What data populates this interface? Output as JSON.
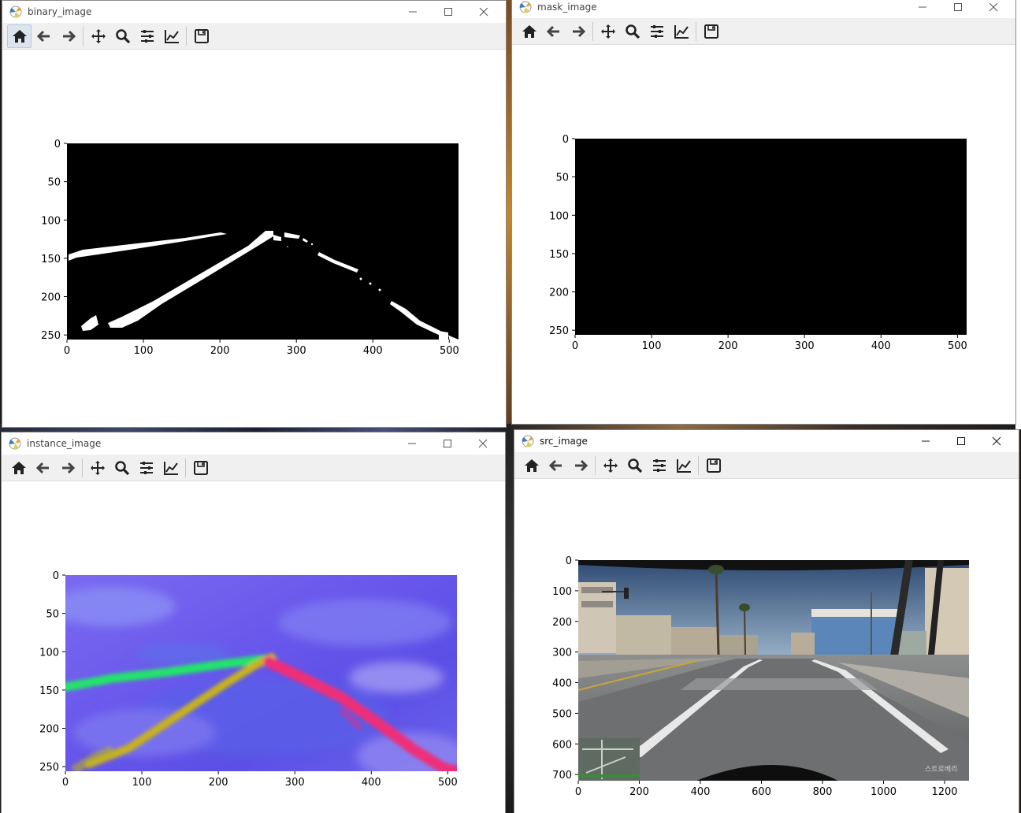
{
  "windows": {
    "binary": {
      "title": "binary_image"
    },
    "mask": {
      "title": "mask_image"
    },
    "instance": {
      "title": "instance_image"
    },
    "src": {
      "title": "src_image"
    }
  },
  "toolbar": {
    "buttons": [
      "home-icon",
      "back-icon",
      "forward-icon",
      "pan-icon",
      "zoom-icon",
      "configure-subplots-icon",
      "edit-axis-icon",
      "save-icon"
    ]
  },
  "window_buttons": [
    "minimize-icon",
    "maximize-icon",
    "close-icon"
  ],
  "colors": {
    "instance_bg": "#6a55ee",
    "lane_green": "#22e46a",
    "lane_yellow": "#c7b21a",
    "lane_pink": "#ef2f78"
  },
  "chart_data": [
    {
      "name": "binary_image",
      "type": "image",
      "x_ticks": [
        "0",
        "100",
        "200",
        "300",
        "400",
        "500"
      ],
      "y_ticks": [
        "0",
        "50",
        "100",
        "150",
        "200",
        "250"
      ],
      "xlim": [
        0,
        512
      ],
      "ylim": [
        256,
        0
      ],
      "content": "binary lane mask"
    },
    {
      "name": "mask_image",
      "type": "image",
      "x_ticks": [
        "0",
        "100",
        "200",
        "300",
        "400",
        "500"
      ],
      "y_ticks": [
        "0",
        "50",
        "100",
        "150",
        "200",
        "250"
      ],
      "xlim": [
        0,
        512
      ],
      "ylim": [
        256,
        0
      ],
      "content": "all black"
    },
    {
      "name": "instance_image",
      "type": "image",
      "x_ticks": [
        "0",
        "100",
        "200",
        "300",
        "400",
        "500"
      ],
      "y_ticks": [
        "0",
        "50",
        "100",
        "150",
        "200",
        "250"
      ],
      "xlim": [
        0,
        512
      ],
      "ylim": [
        256,
        0
      ],
      "content": "instance embedding"
    },
    {
      "name": "src_image",
      "type": "image",
      "x_ticks": [
        "0",
        "200",
        "400",
        "600",
        "800",
        "1000",
        "1200"
      ],
      "y_ticks": [
        "0",
        "100",
        "200",
        "300",
        "400",
        "500",
        "600",
        "700"
      ],
      "xlim": [
        0,
        1280
      ],
      "ylim": [
        720,
        0
      ],
      "content": "road scene photo",
      "watermark": "스트로베리"
    }
  ]
}
